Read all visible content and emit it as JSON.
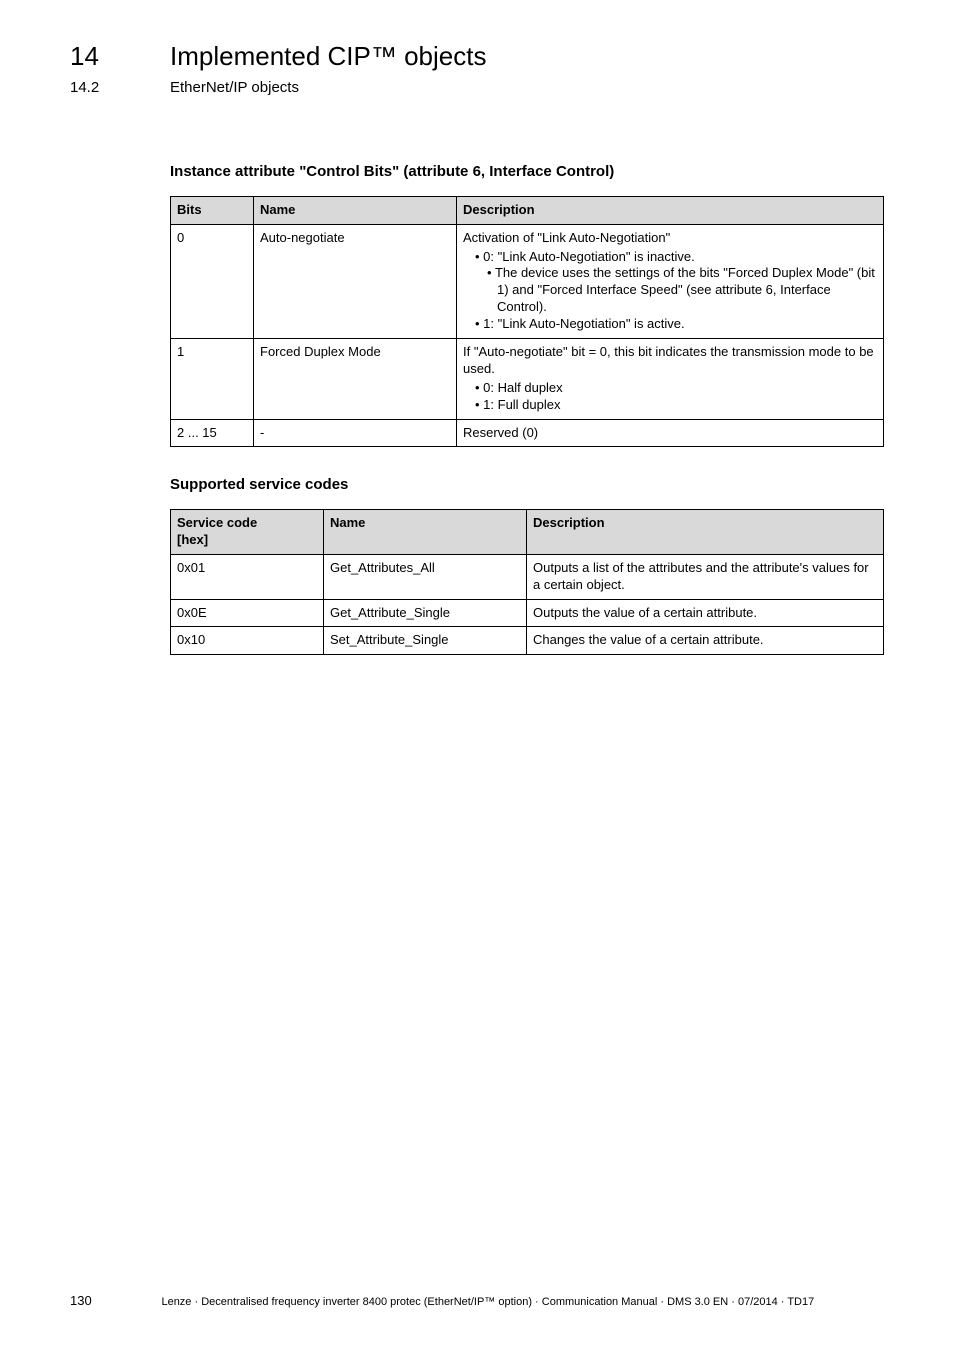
{
  "header": {
    "chapter_num": "14",
    "chapter_title": "Implemented CIP™ objects",
    "section_num": "14.2",
    "section_title": "EtherNet/IP objects"
  },
  "dash_rule": "_  _  _  _  _  _  _  _  _  _  _  _  _  _  _  _  _  _  _  _  _  _  _  _  _  _  _  _  _  _  _  _  _  _  _  _  _  _  _  _  _  _  _  _  _  _  _  _  _  _  _  _  _  _  _  _  _  _  _  _  _  _  _  _",
  "sub1": "Instance attribute \"Control Bits\" (attribute 6, Interface Control)",
  "table1": {
    "headers": {
      "bits": "Bits",
      "name": "Name",
      "desc": "Description"
    },
    "rows": [
      {
        "bits": "0",
        "name": "Auto-negotiate",
        "desc_lead": "Activation of \"Link Auto-Negotiation\"",
        "b1": "0: \"Link Auto-Negotiation\" is inactive.",
        "b1a": "The device uses the settings of the bits \"Forced Duplex Mode\" (bit 1) and \"Forced Interface Speed\" (see attribute 6, Interface Control).",
        "b2": "1: \"Link Auto-Negotiation\" is active."
      },
      {
        "bits": "1",
        "name": "Forced Duplex Mode",
        "desc_lead": "If \"Auto-negotiate\" bit = 0, this bit indicates the transmission mode to be used.",
        "b1": "0: Half duplex",
        "b2": "1: Full duplex"
      },
      {
        "bits": "2 ... 15",
        "name": "-",
        "desc_lead": "Reserved (0)"
      }
    ]
  },
  "sub2": "Supported service codes",
  "table2": {
    "headers": {
      "sc": "Service code\n[hex]",
      "name": "Name",
      "desc": "Description"
    },
    "rows": [
      {
        "sc": "0x01",
        "name": "Get_Attributes_All",
        "desc": "Outputs a list of the attributes and the attribute's values for a certain object."
      },
      {
        "sc": "0x0E",
        "name": "Get_Attribute_Single",
        "desc": "Outputs the value of a certain attribute."
      },
      {
        "sc": "0x10",
        "name": "Set_Attribute_Single",
        "desc": "Changes the value of a certain attribute."
      }
    ]
  },
  "footer": {
    "page": "130",
    "credit": "Lenze · Decentralised frequency inverter 8400 protec (EtherNet/IP™ option) · Communication Manual · DMS 3.0 EN · 07/2014 · TD17"
  }
}
